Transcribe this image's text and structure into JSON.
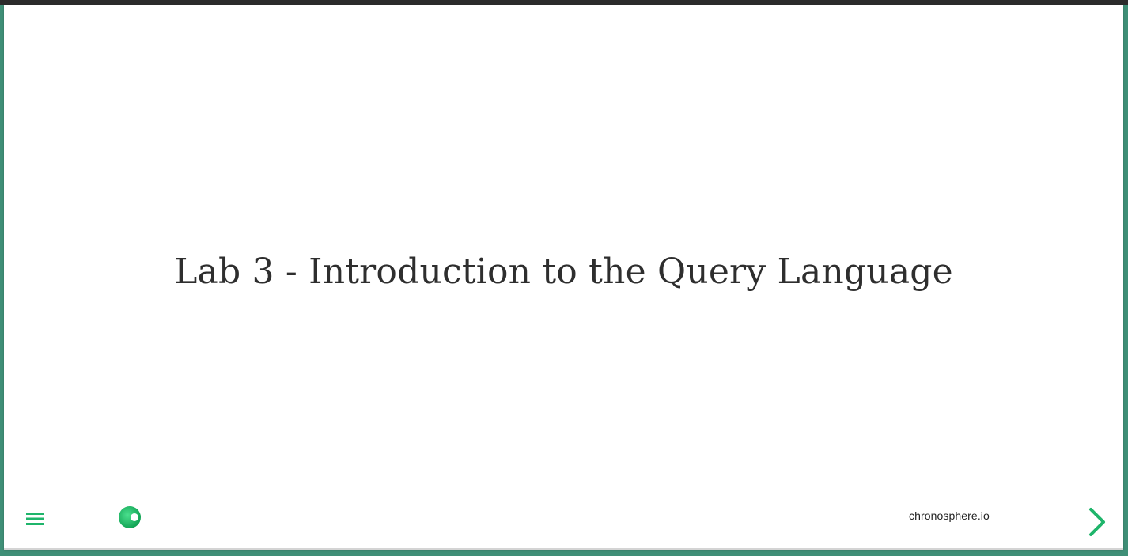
{
  "slide": {
    "title": "Lab 3 - Introduction to the Query Language"
  },
  "footer": {
    "domain": "chronosphere.io",
    "menu_icon": "menu-icon",
    "logo_icon": "chronosphere-logo-icon",
    "next_icon": "chevron-right-icon"
  },
  "colors": {
    "accent": "#1fb56b",
    "background": "#3f8f77",
    "text": "#2e2e2e"
  }
}
